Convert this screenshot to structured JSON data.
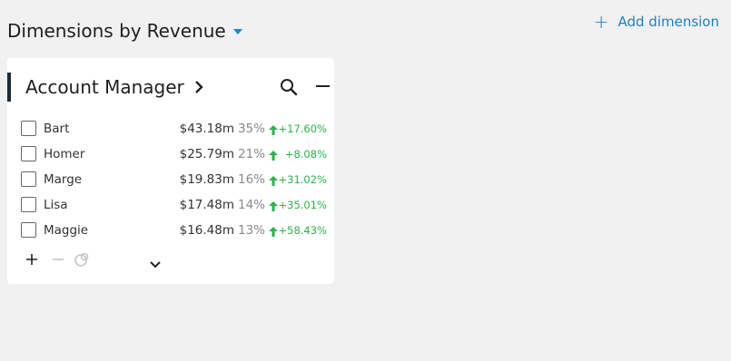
{
  "header": {
    "title_prefix": "Dimensions by",
    "metric": "Revenue",
    "add_dimension_label": "Add dimension"
  },
  "card": {
    "title": "Account Manager",
    "rows": [
      {
        "name": "Bart",
        "value": "$43.18m",
        "share": "35%",
        "change": "+17.60%",
        "trend": "up"
      },
      {
        "name": "Homer",
        "value": "$25.79m",
        "share": "21%",
        "change": "+8.08%",
        "trend": "up"
      },
      {
        "name": "Marge",
        "value": "$19.83m",
        "share": "16%",
        "change": "+31.02%",
        "trend": "up"
      },
      {
        "name": "Lisa",
        "value": "$17.48m",
        "share": "14%",
        "change": "+35.01%",
        "trend": "up"
      },
      {
        "name": "Maggie",
        "value": "$16.48m",
        "share": "13%",
        "change": "+58.43%",
        "trend": "up"
      }
    ]
  },
  "colors": {
    "accent": "#1d7fc2",
    "positive": "#2bb24c",
    "card_marker": "#1e2a33"
  }
}
